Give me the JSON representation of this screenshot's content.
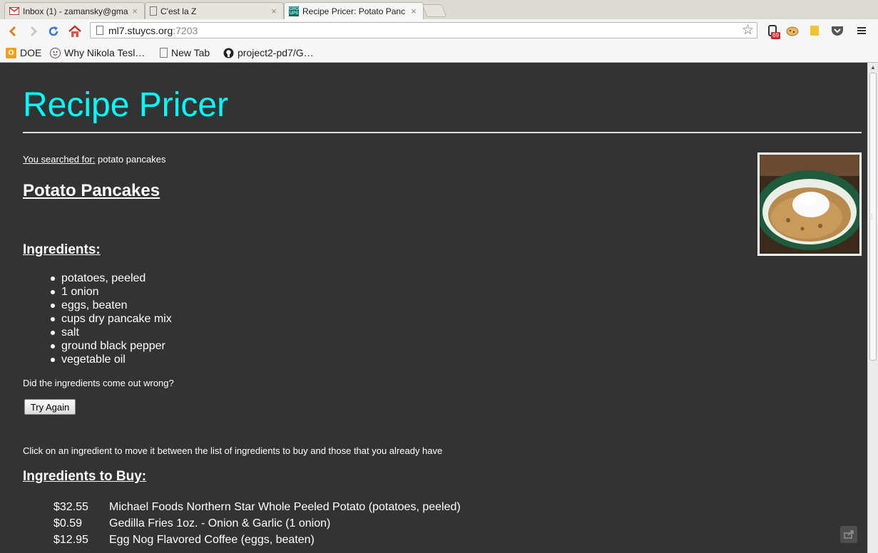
{
  "browser": {
    "tabs": [
      {
        "title": "Inbox (1) - zamansky@gma",
        "icon": "gmail-icon"
      },
      {
        "title": "C'est la Z",
        "icon": "page-icon"
      },
      {
        "title": "Recipe Pricer: Potato Panc",
        "icon": "groups-icon",
        "icon_text": "GRO UPS",
        "active": true
      }
    ],
    "close_glyph": "×",
    "url": {
      "host": "ml7.stuycs.org",
      "port": ":7203"
    },
    "badge_count": "69",
    "bookmarks": [
      {
        "label": "DOE",
        "icon": "doe-icon"
      },
      {
        "label": "Why Nikola Tesl…",
        "icon": "face-icon"
      },
      {
        "label": "New Tab",
        "icon": "page-icon"
      },
      {
        "label": "project2-pd7/G…",
        "icon": "github-icon"
      }
    ]
  },
  "page": {
    "site_title": "Recipe Pricer",
    "search": {
      "label": "You searched for:",
      "query": " potato pancakes"
    },
    "dish_name": "Potato Pancakes",
    "ingredients_heading": "Ingredients:",
    "ingredients": [
      "potatoes, peeled",
      "1 onion",
      "eggs, beaten",
      "cups dry pancake mix",
      "salt",
      "ground black pepper",
      "vegetable oil"
    ],
    "wrong_question": "Did the ingredients come out wrong?",
    "try_again_label": "Try Again",
    "click_hint": "Click on an ingredient to move it between the list of ingredients to buy and those that you already have",
    "buy_heading": "Ingredients to Buy:",
    "buy_items": [
      {
        "price": "$32.55",
        "desc": "Michael Foods Northern Star Whole Peeled Potato (potatoes, peeled)"
      },
      {
        "price": "$0.59",
        "desc": "Gedilla Fries 1oz. - Onion & Garlic (1 onion)"
      },
      {
        "price": "$12.95",
        "desc": "Egg Nog Flavored Coffee (eggs, beaten)"
      }
    ]
  },
  "colors": {
    "title": "#00ffff",
    "background": "#333333",
    "text": "#ffffff"
  }
}
